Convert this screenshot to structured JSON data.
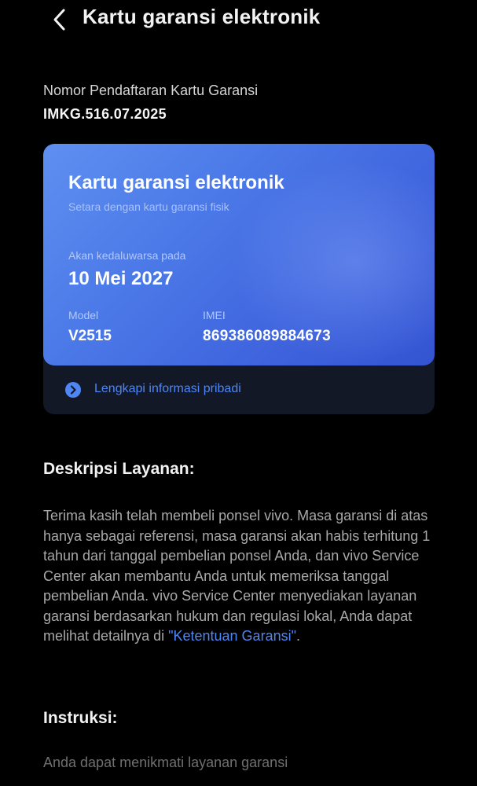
{
  "header": {
    "title": "Kartu garansi elektronik",
    "back_icon": "chevron-left-icon"
  },
  "registration": {
    "label": "Nomor Pendaftaran Kartu Garansi",
    "value": "IMKG.516.07.2025"
  },
  "card": {
    "title": "Kartu garansi elektronik",
    "subtitle": "Setara dengan kartu garansi fisik",
    "expire_label": "Akan kedaluwarsa pada",
    "expire_value": "10 Mei 2027",
    "model_label": "Model",
    "model_value": "V2515",
    "imei_label": "IMEI",
    "imei_value": "869386089884673",
    "complete_info_label": "Lengkapi informasi pribadi",
    "complete_info_icon": "circle-chevron-right-icon"
  },
  "description": {
    "title": "Deskripsi Layanan:",
    "body": "Terima kasih telah membeli ponsel vivo. Masa garansi di atas hanya sebagai referensi, masa garansi akan habis terhitung 1 tahun dari tanggal pembelian ponsel Anda, dan vivo Service Center akan membantu Anda untuk memeriksa tanggal pembelian Anda. vivo Service Center menyediakan layanan garansi berdasarkan hukum dan regulasi lokal, Anda dapat melihat detailnya di ",
    "link_text": "\"Ketentuan Garansi\"",
    "body_end": "."
  },
  "instructions": {
    "title": "Instruksi:",
    "body": "Anda dapat menikmati layanan garansi"
  },
  "colors": {
    "background": "#000000",
    "card_gradient_start": "#5f8ff0",
    "card_gradient_end": "#3454d2",
    "accent_link": "#4f86f5",
    "card_footer": "#121826"
  }
}
